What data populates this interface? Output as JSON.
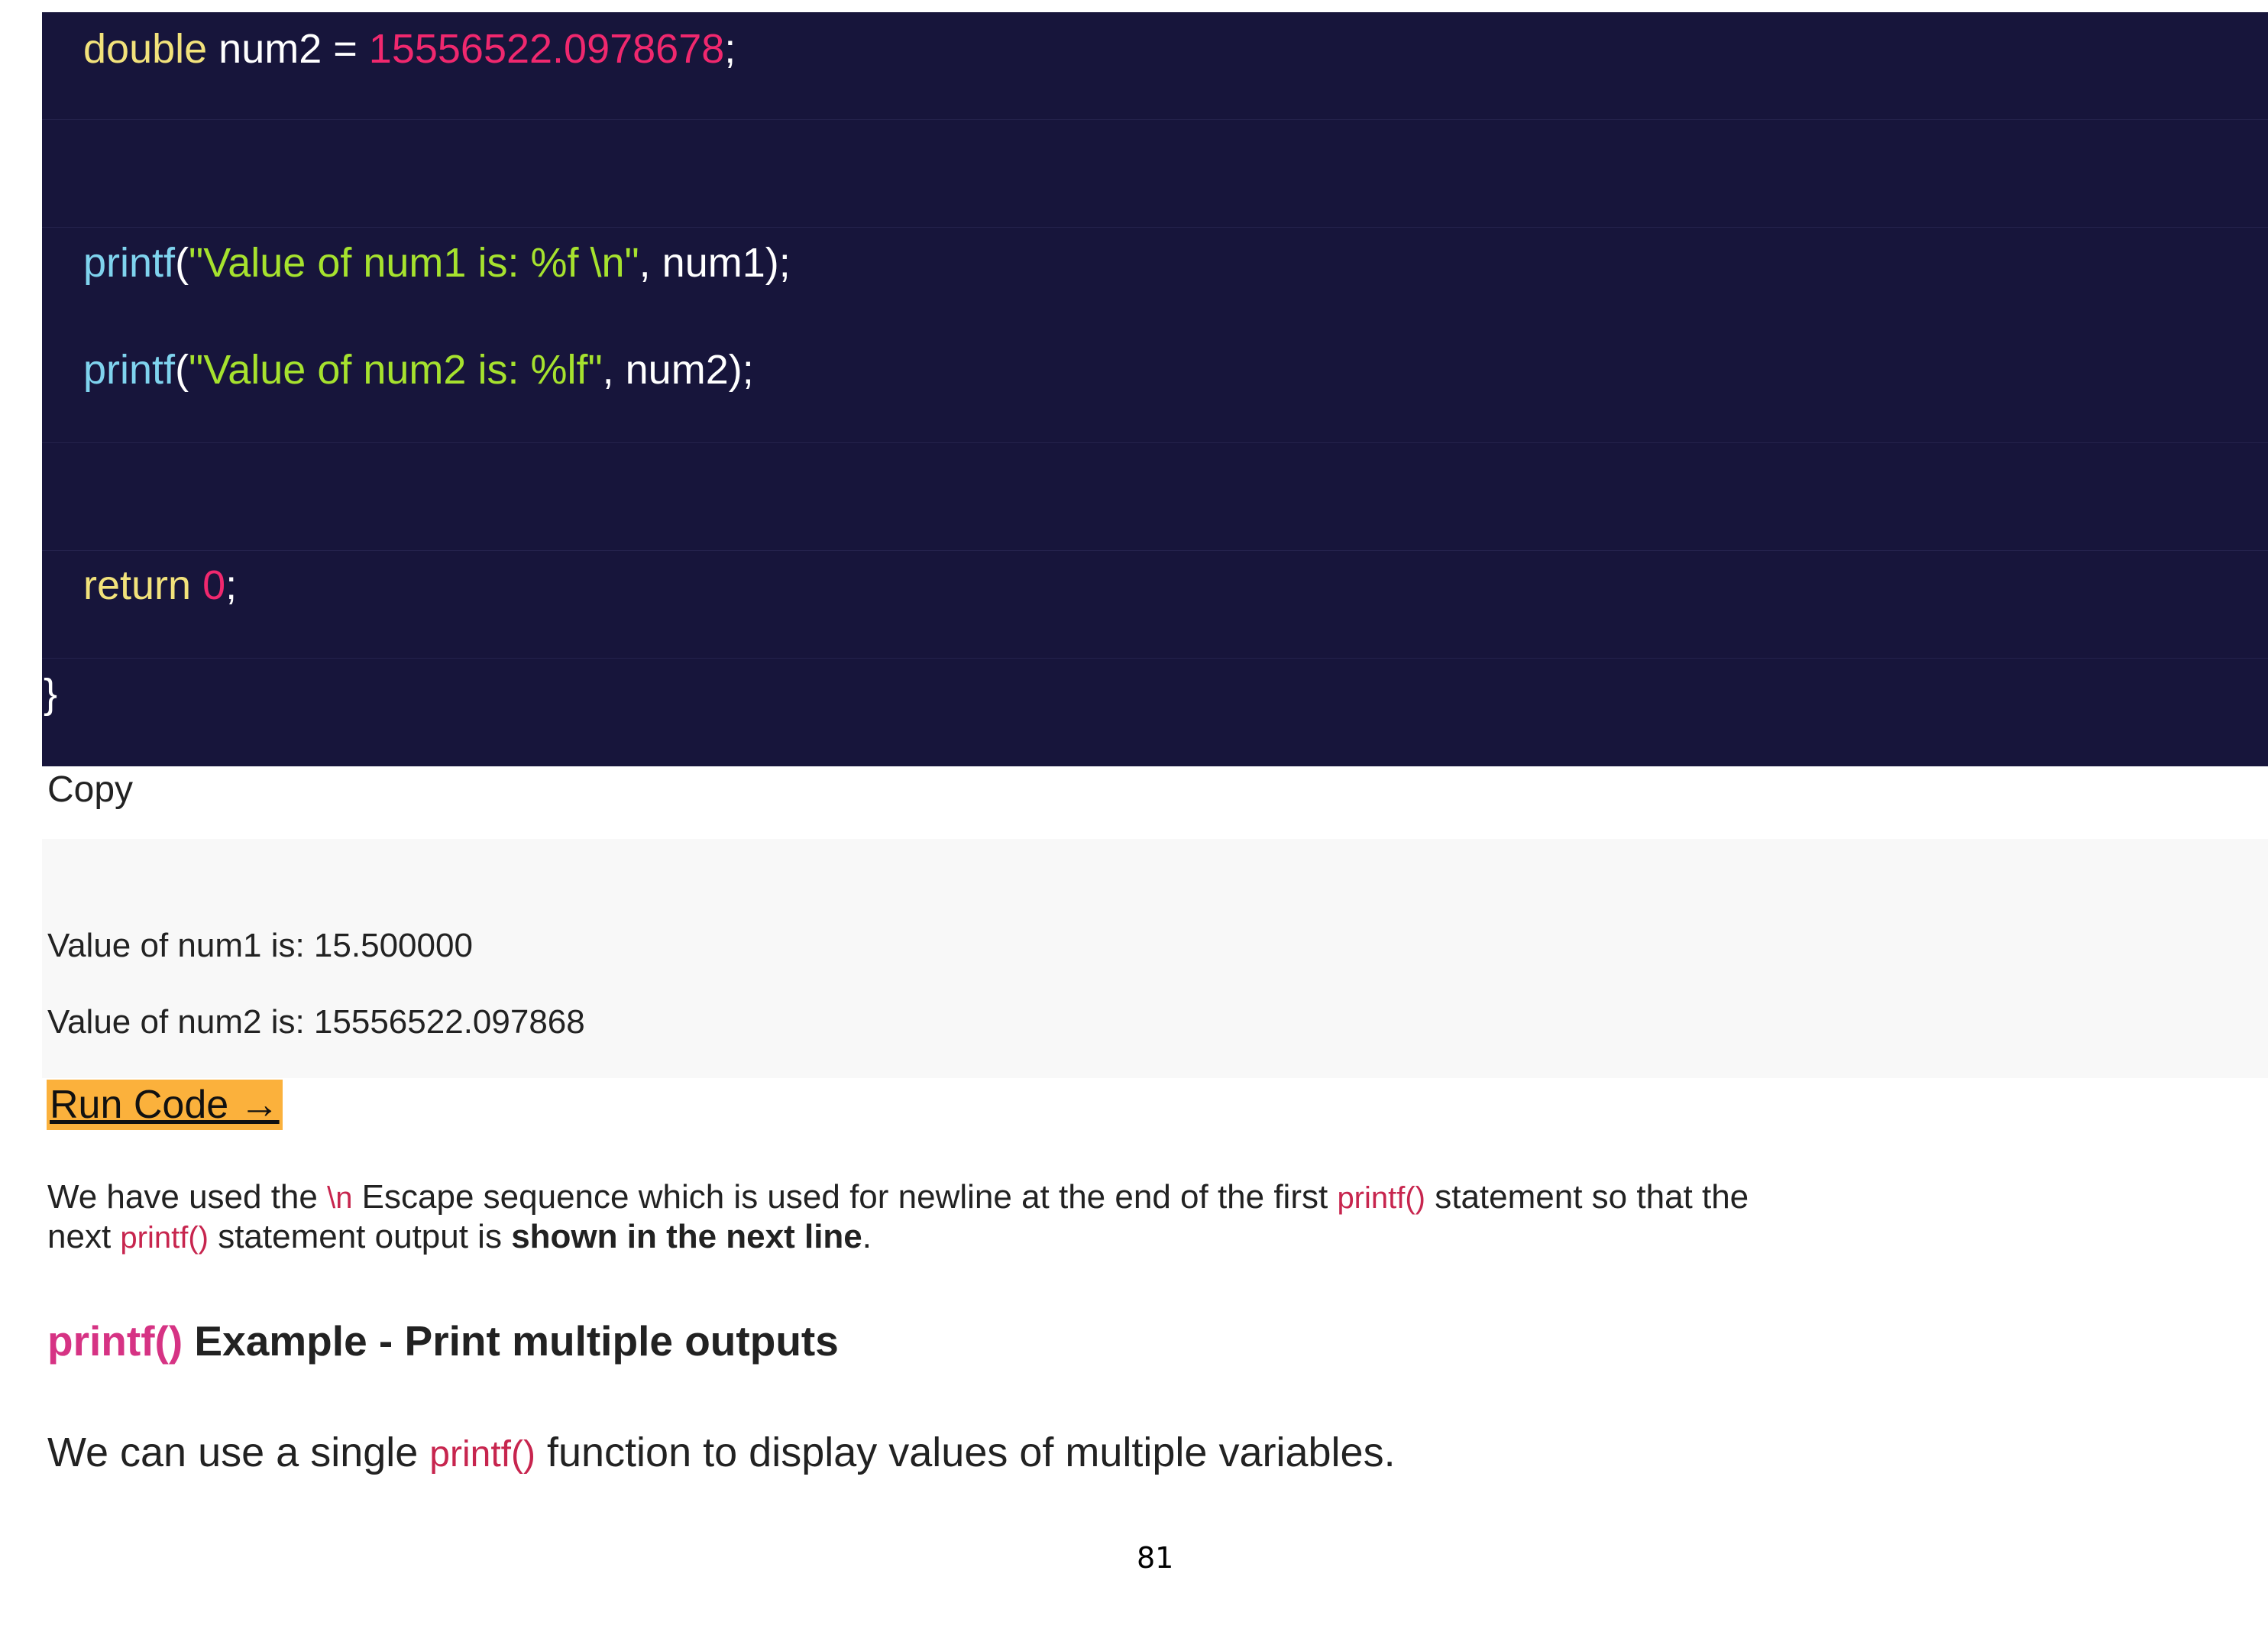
{
  "code": {
    "line1": {
      "type": "double",
      "rest": " num2 = ",
      "number": "15556522.0978678",
      "end": ";"
    },
    "line3": {
      "fn": "printf",
      "open": "(",
      "string": "\"Value of num1 is: %f \\n\"",
      "rest": ", num1);"
    },
    "line4": {
      "fn": "printf",
      "open": "(",
      "string": "\"Value of num2 is: %lf\"",
      "rest": ", num2);"
    },
    "line6": {
      "keyword": "return",
      "space": " ",
      "number": "0",
      "end": ";"
    },
    "line7": {
      "brace": "}"
    }
  },
  "copy_label": "Copy",
  "output": {
    "line1": "Value of num1 is: 15.500000",
    "line2": "Value of num2 is: 15556522.097868"
  },
  "run_button": {
    "label": "Run Code →"
  },
  "paragraph": {
    "p1": "We have used the ",
    "code1": "\\n",
    "p2": " Escape sequence which is used for newline at the end of the first ",
    "code2": "printf()",
    "p3": " statement so that the",
    "p4": "next ",
    "code3": "printf()",
    "p5": " statement output is ",
    "bold": "shown in the next line",
    "p6": "."
  },
  "heading": {
    "fn": "printf()",
    "text": " Example - Print multiple outputs"
  },
  "lead": {
    "p1": "We can use a single ",
    "code": "printf()",
    "p2": " function to display values of multiple variables."
  },
  "page_number": "81",
  "colors": {
    "code_background": "#17153b",
    "type_keyword": "#f2e27b",
    "function": "#7fd3ee",
    "string": "#a6e22e",
    "number": "#f0286e",
    "inline_code": "#c7254e",
    "run_button": "#fbb13c"
  }
}
